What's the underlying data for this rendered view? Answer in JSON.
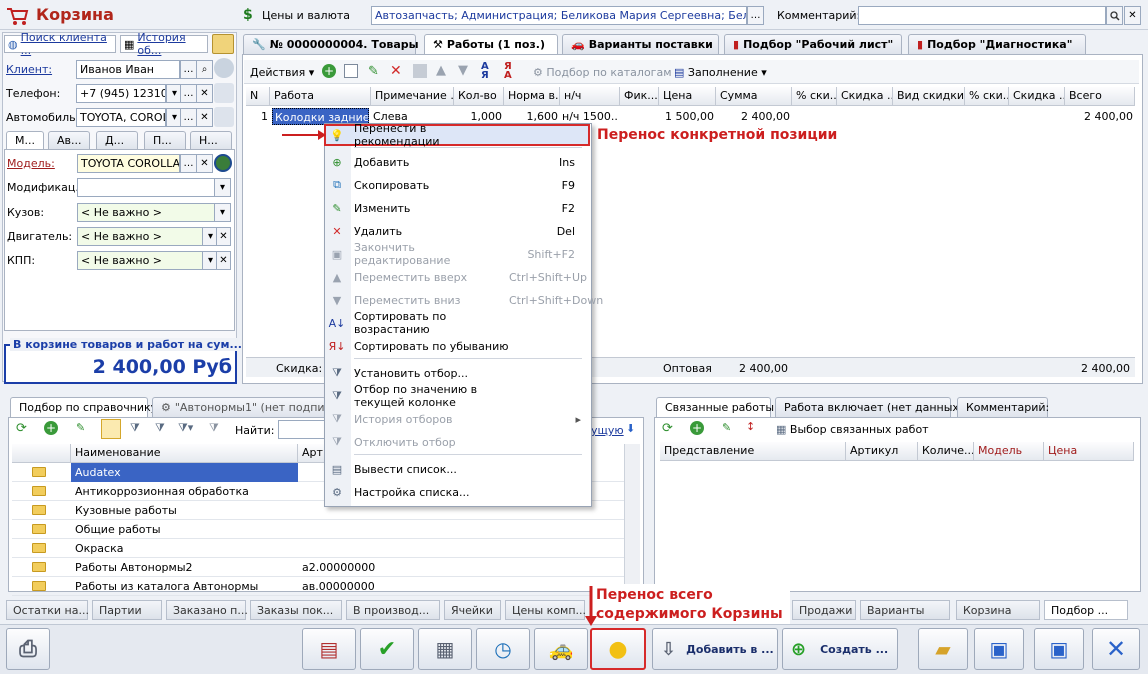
{
  "window": {
    "title": "Корзина",
    "prices_label": "Цены и валюта",
    "info_field": "Автозапчасть; Администрация; Беликова Мария Сергеевна; Беликова М",
    "comment_label": "Комментарий:"
  },
  "left": {
    "search_client": "Поиск клиента ...",
    "history": "История об...",
    "client_label": "Клиент:",
    "client_value": "Иванов Иван",
    "phone_label": "Телефон:",
    "phone_value": "+7 (945) 1231010",
    "auto_label": "Автомобиль:",
    "auto_value": "TOYOTA, COROL",
    "subtabs": [
      "М...",
      "Ав...",
      "Д...",
      "П...",
      "Н..."
    ],
    "model_label": "Модель:",
    "model_value": "TOYOTA COROLLA",
    "modif_label": "Модификац.:",
    "body_label": "Кузов:",
    "body_value": "< Не важно >",
    "engine_label": "Двигатель:",
    "engine_value": "< Не важно >",
    "kpp_label": "КПП:",
    "kpp_value": "< Не важно >",
    "total_caption": "В корзине товаров и работ на сум...",
    "total_value": "2 400,00 Руб"
  },
  "tabs": [
    "№ 0000000004. Товары",
    "Работы (1 поз.)",
    "Варианты поставки",
    "Подбор \"Рабочий лист\"",
    "Подбор \"Диагностика\""
  ],
  "toolbar": {
    "actions": "Действия",
    "by_catalog": "Подбор по каталогам",
    "fill": "Заполнение"
  },
  "grid": {
    "headers": [
      "N",
      "Работа",
      "Примечание ...",
      "Кол-во",
      "Норма в...",
      "н/ч",
      "Фик...",
      "Цена",
      "Сумма",
      "% ски...",
      "Скидка ...",
      "Вид скидки",
      "% ски...",
      "Скидка ...",
      "Всего"
    ],
    "row": [
      "1",
      "Колодки задние...",
      "Слева",
      "1,000",
      "1,600",
      "н/ч 1500...",
      "",
      "1 500,00",
      "2 400,00",
      "",
      "",
      "",
      "",
      "",
      "2 400,00"
    ],
    "footer_discount": "Скидка: <",
    "footer_wholesale": "Оптовая",
    "footer_sum": "2 400,00",
    "footer_total": "2 400,00"
  },
  "context_menu": {
    "items": [
      {
        "label": "Перенести в рекомендации",
        "shortcut": "",
        "disabled": false
      },
      {
        "label": "Добавить",
        "shortcut": "Ins",
        "disabled": false
      },
      {
        "label": "Скопировать",
        "shortcut": "F9",
        "disabled": false
      },
      {
        "label": "Изменить",
        "shortcut": "F2",
        "disabled": false
      },
      {
        "label": "Удалить",
        "shortcut": "Del",
        "disabled": false
      },
      {
        "label": "Закончить редактирование",
        "shortcut": "Shift+F2",
        "disabled": true
      },
      {
        "label": "Переместить вверх",
        "shortcut": "Ctrl+Shift+Up",
        "disabled": true
      },
      {
        "label": "Переместить вниз",
        "shortcut": "Ctrl+Shift+Down",
        "disabled": true
      },
      {
        "label": "Сортировать по возрастанию",
        "shortcut": "",
        "disabled": false
      },
      {
        "label": "Сортировать по убыванию",
        "shortcut": "",
        "disabled": false
      },
      {
        "label": "Установить отбор...",
        "shortcut": "",
        "disabled": false
      },
      {
        "label": "Отбор по значению в текущей колонке",
        "shortcut": "",
        "disabled": false
      },
      {
        "label": "История отборов",
        "shortcut": "",
        "disabled": true
      },
      {
        "label": "Отключить отбор",
        "shortcut": "",
        "disabled": true
      },
      {
        "label": "Вывести список...",
        "shortcut": "",
        "disabled": false
      },
      {
        "label": "Настройка списка...",
        "shortcut": "",
        "disabled": false
      }
    ]
  },
  "annotations": {
    "one": "Перенос конкретной позиции",
    "all_line1": "Перенос всего",
    "all_line2": "содержимого Корзины"
  },
  "lower_left": {
    "tab1": "Подбор по справочнику",
    "tab2": "\"Автонормы1\" (нет подпис",
    "find_label": "Найти:",
    "link_partial": "ущую",
    "col_name": "Наименование",
    "col_art": "Арт",
    "rows": [
      {
        "name": "Audatex",
        "art": ""
      },
      {
        "name": "Антикоррозионная обработка",
        "art": ""
      },
      {
        "name": "Кузовные работы",
        "art": ""
      },
      {
        "name": "Общие работы",
        "art": ""
      },
      {
        "name": "Окраска",
        "art": ""
      },
      {
        "name": "Работы Автонормы2",
        "art": "а2.00000000"
      },
      {
        "name": "Работы из каталога Автонормы",
        "art": "ав.00000000"
      }
    ]
  },
  "lower_right": {
    "tabs": [
      "Связанные работы",
      "Работа включает (нет данных):",
      "Комментарий:"
    ],
    "select_related": "Выбор связанных работ",
    "cols": [
      "Представление",
      "Артикул",
      "Количе...",
      "Модель",
      "Цена"
    ]
  },
  "bottom_tabs": [
    "Остатки на...",
    "Партии",
    "Заказано п...",
    "Заказы пок...",
    "В производ...",
    "Ячейки",
    "Цены комп...",
    "Продажи",
    "Варианты",
    "Корзина",
    "Подбор ..."
  ],
  "bottom_buttons": {
    "add_to": "Добавить в ...",
    "create": "Создать ..."
  },
  "colors": {
    "accent_red": "#cc1f1f",
    "title_red": "#b1261b",
    "total_blue": "#1b3ea8"
  }
}
